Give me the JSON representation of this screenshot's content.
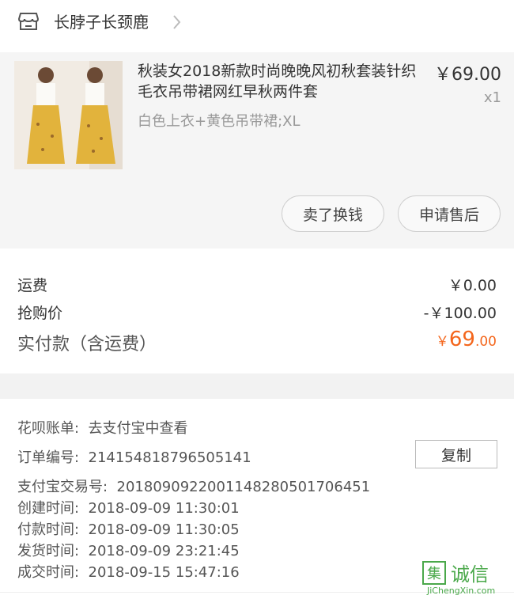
{
  "shop": {
    "name": "长脖子长颈鹿",
    "icon": "store-icon",
    "chevron": "chevron-right-icon"
  },
  "product": {
    "title": "秋装女2018新款时尚晚晚风初秋套装针织毛衣吊带裙网红早秋两件套",
    "price": "￥69.00",
    "quantity": "x1",
    "spec": "白色上衣+黄色吊带裙;XL",
    "buttons": {
      "sell": "卖了换钱",
      "after_sale": "申请售后"
    }
  },
  "totals": {
    "shipping_label": "运费",
    "shipping_value": "￥0.00",
    "discount_label": "抢购价",
    "discount_value": "-￥100.00",
    "paid_label": "实付款（含运费）",
    "paid_currency": "￥",
    "paid_int": "69",
    "paid_dec": ".00"
  },
  "order_info": {
    "huabei_label": "花呗账单:",
    "huabei_value": "去支付宝中查看",
    "order_no_label": "订单编号:",
    "order_no_value": "214154818796505141",
    "copy_label": "复制",
    "alipay_label": "支付宝交易号:",
    "alipay_value": "2018090922001148280501706451",
    "created_label": "创建时间:",
    "created_value": "2018-09-09 11:30:01",
    "paid_label": "付款时间:",
    "paid_value": "2018-09-09 11:30:05",
    "shipped_label": "发货时间:",
    "shipped_value": "2018-09-09 23:21:45",
    "completed_label": "成交时间:",
    "completed_value": "2018-09-15 15:47:16"
  },
  "watermark": {
    "badge": "集",
    "text": "诚信",
    "url": "JiChengXin.com"
  },
  "colors": {
    "accent": "#f4661c",
    "watermark": "#4aa84a"
  }
}
